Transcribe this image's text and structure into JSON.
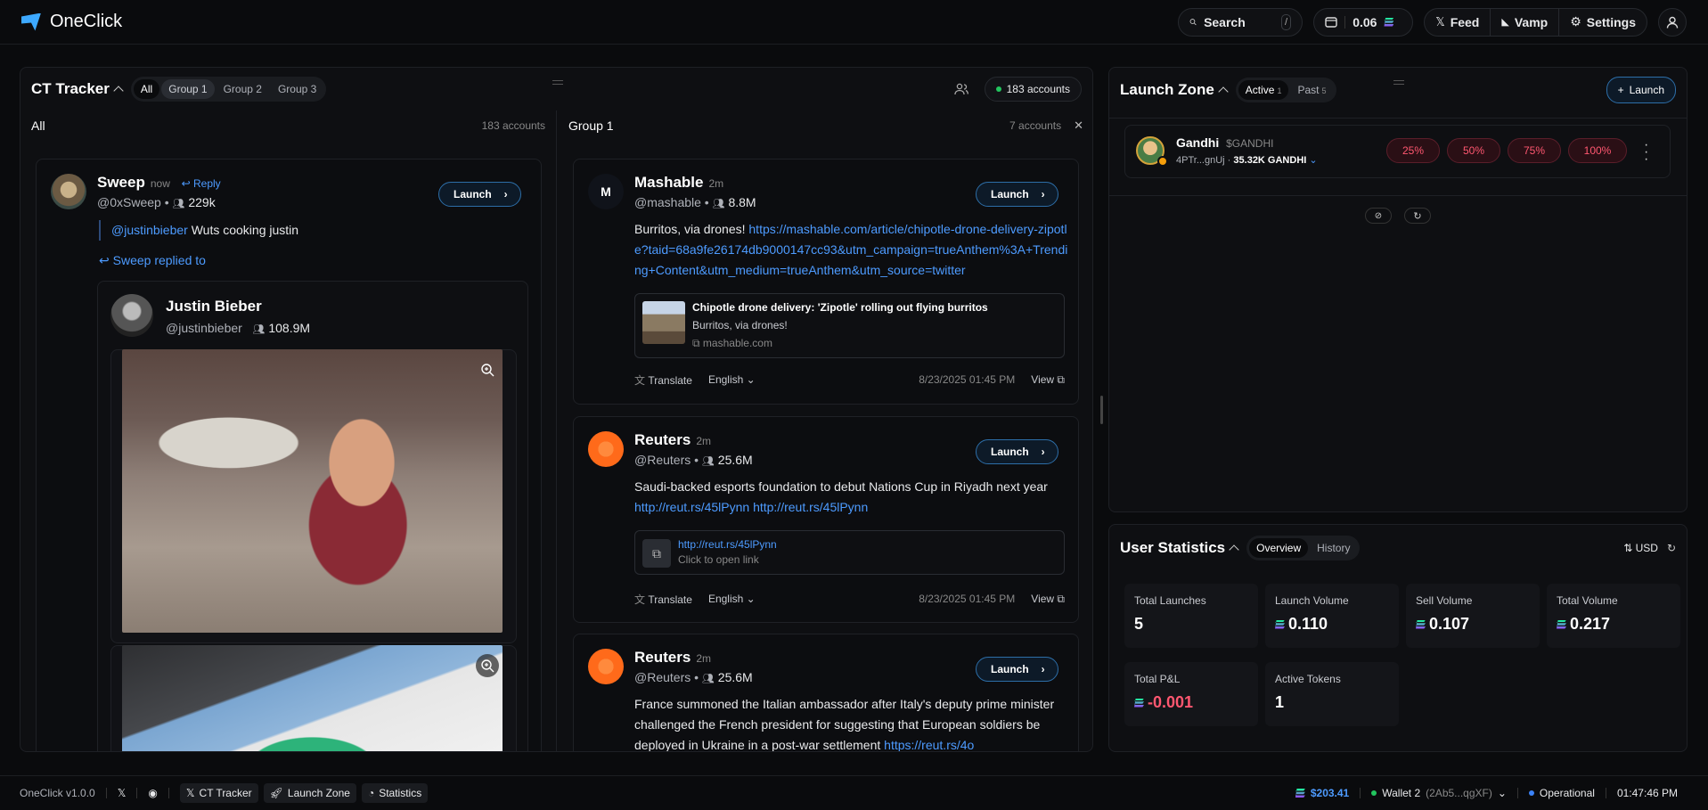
{
  "app": {
    "name": "OneClick",
    "version": "OneClick v1.0.0"
  },
  "topbar": {
    "search_label": "Search",
    "search_shortcut": "/",
    "balance": "0.06",
    "nav": [
      "Feed",
      "Vamp",
      "Settings"
    ]
  },
  "ct_tracker": {
    "title": "CT Tracker",
    "groups": [
      "All",
      "Group 1",
      "Group 2",
      "Group 3"
    ],
    "accounts_badge": "183 accounts",
    "columns": [
      {
        "title": "All",
        "count": "183 accounts"
      },
      {
        "title": "Group 1",
        "count": "7 accounts"
      }
    ]
  },
  "sweep_post": {
    "name": "Sweep",
    "ago": "now",
    "reply_label": "Reply",
    "handle": "@0xSweep",
    "followers": "229k",
    "mention": "@justinbieber",
    "text": " Wuts cooking justin",
    "replied_to": "Sweep replied to",
    "launch": "Launch",
    "quoted": {
      "name": "Justin Bieber",
      "handle": "@justinbieber",
      "followers": "108.9M"
    }
  },
  "group_posts": [
    {
      "name": "Mashable",
      "ago": "2m",
      "handle": "@mashable",
      "followers": "8.8M",
      "launch": "Launch",
      "text": "Burritos, via drones! ",
      "link": "https://mashable.com/article/chipotle-drone-delivery-zipotle?taid=68a9fe26174db9000147cc93&utm_campaign=trueAnthem%3A+Trending+Content&utm_medium=trueAnthem&utm_source=twitter",
      "preview": {
        "title": "Chipotle drone delivery: 'Zipotle' rolling out flying burritos",
        "desc": "Burritos, via drones!",
        "domain": "mashable.com"
      },
      "translate": "Translate",
      "language": "English",
      "time": "8/23/2025 01:45 PM",
      "view": "View"
    },
    {
      "name": "Reuters",
      "ago": "2m",
      "handle": "@Reuters",
      "followers": "25.6M",
      "launch": "Launch",
      "text": "Saudi-backed esports foundation to debut Nations Cup in Riyadh next year",
      "link": "http://reut.rs/45lPynn http://reut.rs/45lPynn",
      "preview": {
        "url": "http://reut.rs/45lPynn",
        "hint": "Click to open link"
      },
      "translate": "Translate",
      "language": "English",
      "time": "8/23/2025 01:45 PM",
      "view": "View"
    },
    {
      "name": "Reuters",
      "ago": "2m",
      "handle": "@Reuters",
      "followers": "25.6M",
      "launch": "Launch",
      "text": "France summoned the Italian ambassador after Italy's deputy prime minister challenged the French president for suggesting that European soldiers be deployed in Ukraine in a post-war settlement ",
      "link": "https://reut.rs/4o"
    }
  ],
  "launch_zone": {
    "title": "Launch Zone",
    "tabs": [
      {
        "label": "Active",
        "count": "1"
      },
      {
        "label": "Past",
        "count": "5"
      }
    ],
    "launch_button": "Launch",
    "token": {
      "name": "Gandhi",
      "ticker": "$GANDHI",
      "address": "4PTr...gnUj",
      "holding": "35.32K GANDHI"
    },
    "percents": [
      "25%",
      "50%",
      "75%",
      "100%"
    ]
  },
  "user_stats": {
    "title": "User Statistics",
    "tabs": [
      "Overview",
      "History"
    ],
    "currency": "USD",
    "cards": [
      {
        "label": "Total Launches",
        "value": "5",
        "sol": false,
        "color": "#ffffff"
      },
      {
        "label": "Launch Volume",
        "value": "0.110",
        "sol": true,
        "color": "#ffffff"
      },
      {
        "label": "Sell Volume",
        "value": "0.107",
        "sol": true,
        "color": "#ffffff"
      },
      {
        "label": "Total Volume",
        "value": "0.217",
        "sol": true,
        "color": "#ffffff"
      },
      {
        "label": "Total P&L",
        "value": "-0.001",
        "sol": true,
        "color": "#ff5770"
      },
      {
        "label": "Active Tokens",
        "value": "1",
        "sol": false,
        "color": "#ffffff"
      }
    ]
  },
  "bottombar": {
    "chips": [
      "CT Tracker",
      "Launch Zone",
      "Statistics"
    ],
    "balance_usd": "$203.41",
    "wallet": "Wallet 2",
    "wallet_addr": "(2Ab5...qgXF)",
    "status": "Operational",
    "clock": "01:47:46 PM"
  }
}
